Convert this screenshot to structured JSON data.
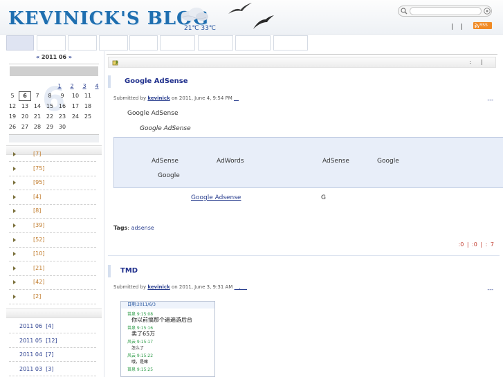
{
  "header": {
    "logo_text": "KEVINICK'S BLOG",
    "weather": "21℃ 33℃",
    "pipes": "| |",
    "rss_label": "RSS",
    "search_placeholder": ""
  },
  "nav": {
    "tab_count": 8,
    "active_index": 0
  },
  "calendar": {
    "prev": "«",
    "month": "2011 06",
    "next": "»",
    "weeks": [
      [
        "",
        "",
        "",
        "",
        "1",
        "2",
        "3",
        "4"
      ],
      [
        "5",
        "6",
        "7",
        "8",
        "9",
        "10",
        "11"
      ],
      [
        "12",
        "13",
        "14",
        "15",
        "16",
        "17",
        "18"
      ],
      [
        "19",
        "20",
        "21",
        "22",
        "23",
        "24",
        "25"
      ],
      [
        "26",
        "27",
        "28",
        "29",
        "30"
      ]
    ],
    "linked_days": [
      "1",
      "2",
      "3",
      "4"
    ],
    "today": "6"
  },
  "categories": [
    "[7]",
    "[75]",
    "[95]",
    "[4]",
    "[8]",
    "[39]",
    "[52]",
    "[10]",
    "[21]",
    "[42]",
    "[2]"
  ],
  "archives": [
    "2011 06  [4]",
    "2011 05  [12]",
    "2011 04  [7]",
    "2011 03  [3]"
  ],
  "toolbar": {
    "right_text": ":  |"
  },
  "posts": [
    {
      "title": "Google AdSense",
      "submitted_prefix": "Submitted by ",
      "author": "kevinick",
      "submitted_suffix": " on 2011, June 4, 9:54 PM ",
      "edit_link": "__",
      "dashes": "---",
      "line1": "Google AdSense",
      "line2_italic": "Google AdSense",
      "ad_words": [
        "AdSense",
        "AdWords",
        "AdSense",
        "Google",
        "Google"
      ],
      "link_text": " Google Adsense ",
      "link_suffix": "G",
      "tags_label": "Tags",
      "tags_sep": ": ",
      "tag": "adsense",
      "stats": ":0 |  :0 |  : 7"
    },
    {
      "title": "TMD",
      "submitted_prefix": "Submitted by ",
      "author": "kevinick",
      "submitted_suffix": " on 2011, June 3, 9:31 AM ",
      "edit_link": "__, __",
      "dashes": "---",
      "screenshot": {
        "date_label": "日期:2011/6/3",
        "lines": [
          {
            "name": "苗泉 9:15:08",
            "msg": "你以前搞那个遍遍游后台"
          },
          {
            "name": "苗泉 9:15:16",
            "msg": "卖了65万"
          },
          {
            "name": "风云 9:15:17",
            "msg": "怎么了"
          },
          {
            "name": "风云 9:15:22",
            "msg": "哦，是嘛"
          },
          {
            "name": "苗泉 9:15:25",
            "msg": ""
          }
        ]
      }
    }
  ]
}
